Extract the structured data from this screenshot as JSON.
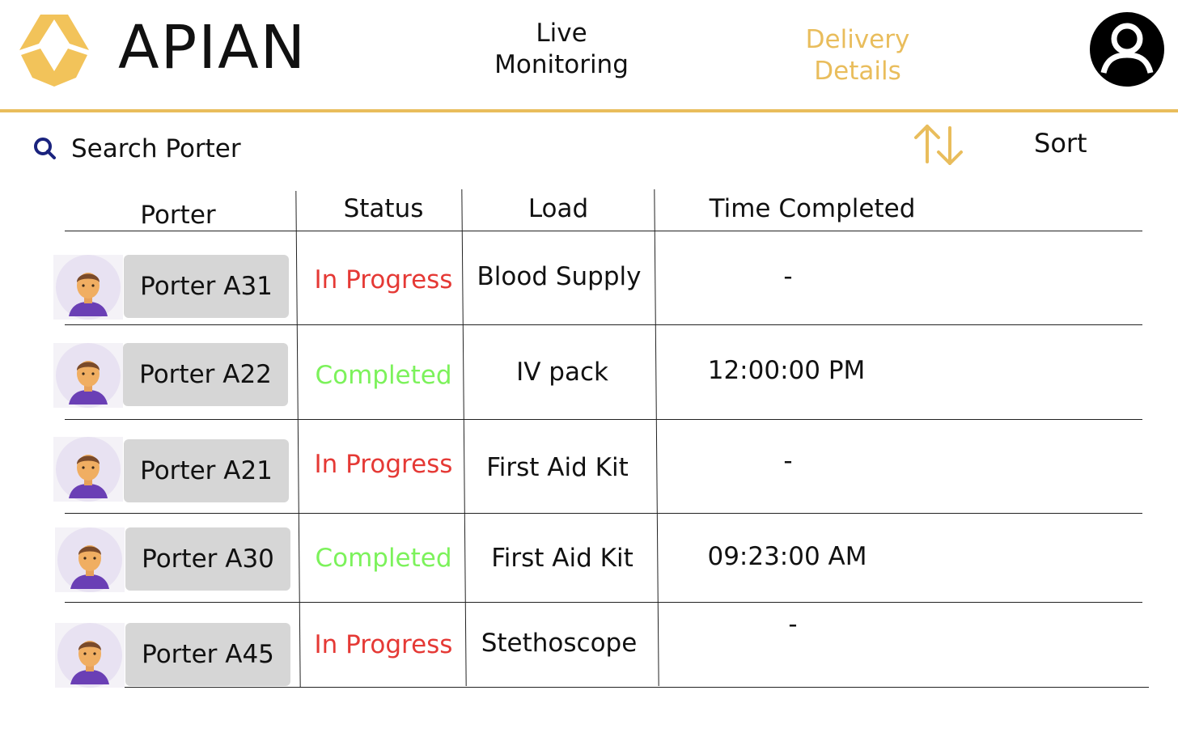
{
  "header": {
    "brand": "APIAN",
    "nav": {
      "live_monitoring": "Live\nMonitoring",
      "delivery_details": "Delivery\nDetails"
    },
    "accent_color": "#E9BD5C",
    "profile_icon": "user-circle-icon"
  },
  "toolbar": {
    "search_placeholder": "Search Porter",
    "search_icon": "search-icon",
    "sort_icon": "sort-arrows-icon",
    "sort_label": "Sort"
  },
  "table": {
    "columns": [
      "Porter",
      "Status",
      "Load",
      "Time Completed"
    ],
    "rows": [
      {
        "porter": "Porter A31",
        "status": "In Progress",
        "load": "Blood Supply",
        "time": "-"
      },
      {
        "porter": "Porter A22",
        "status": "Completed",
        "load": "IV pack",
        "time": "12:00:00 PM"
      },
      {
        "porter": "Porter A21",
        "status": "In Progress",
        "load": "First Aid Kit",
        "time": "-"
      },
      {
        "porter": "Porter A30",
        "status": "Completed",
        "load": "First Aid Kit",
        "time": "09:23:00 AM"
      },
      {
        "porter": "Porter A45",
        "status": "In Progress",
        "load": "Stethoscope",
        "time": "-"
      }
    ],
    "status_colors": {
      "In Progress": "#E53935",
      "Completed": "#7CF25B"
    }
  }
}
